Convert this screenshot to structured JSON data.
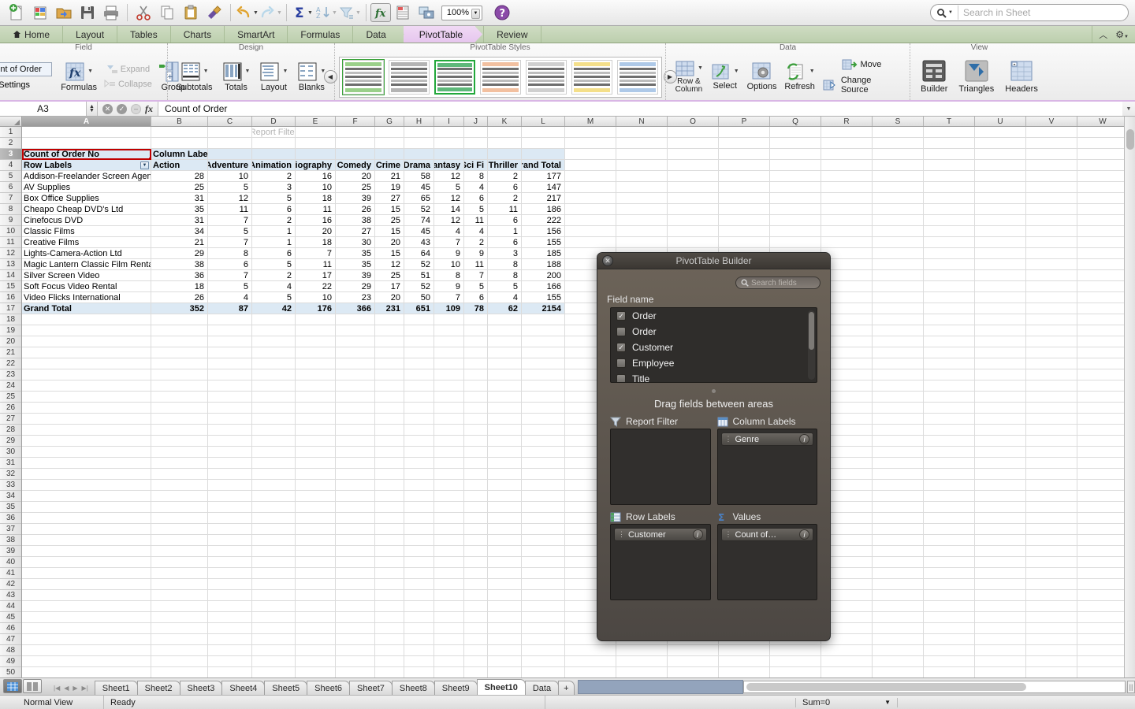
{
  "app": {
    "zoom_level": "100%",
    "search_placeholder": "Search in Sheet"
  },
  "toolbar": {
    "items": [
      {
        "name": "new-document-icon",
        "label": "New"
      },
      {
        "name": "open-template-icon",
        "label": "Templates"
      },
      {
        "name": "open-folder-icon",
        "label": "Open"
      },
      {
        "name": "save-icon",
        "label": "Save"
      },
      {
        "name": "print-icon",
        "label": "Print"
      },
      {
        "name": "cut-icon",
        "label": "Cut"
      },
      {
        "name": "copy-icon",
        "label": "Copy"
      },
      {
        "name": "paste-icon",
        "label": "Paste"
      },
      {
        "name": "format-painter-icon",
        "label": "Format"
      },
      {
        "name": "undo-icon",
        "label": "Undo"
      },
      {
        "name": "redo-icon",
        "label": "Redo"
      },
      {
        "name": "autosum-icon",
        "label": "AutoSum"
      },
      {
        "name": "sort-az-icon",
        "label": "Sort"
      },
      {
        "name": "filter-icon",
        "label": "Filter"
      },
      {
        "name": "formula-builder-icon",
        "label": "Formula Builder"
      },
      {
        "name": "toolbox-icon",
        "label": "Toolbox"
      },
      {
        "name": "media-browser-icon",
        "label": "Media"
      }
    ],
    "help_label": "?"
  },
  "ribbon_tabs": [
    {
      "label": "Home",
      "icon": "home-icon",
      "active": false
    },
    {
      "label": "Layout",
      "active": false
    },
    {
      "label": "Tables",
      "active": false
    },
    {
      "label": "Charts",
      "active": false
    },
    {
      "label": "SmartArt",
      "active": false
    },
    {
      "label": "Formulas",
      "active": false
    },
    {
      "label": "Data",
      "active": false
    },
    {
      "label": "PivotTable",
      "active": true
    },
    {
      "label": "Review",
      "active": false
    }
  ],
  "ribbon": {
    "groups": [
      {
        "title": "Field",
        "field_name_value": "Count of Order",
        "settings_label": "Settings",
        "items": [
          {
            "label": "Formulas",
            "icon": "formulas-icon",
            "enabled": true,
            "caret": true
          },
          {
            "label": "Expand",
            "icon": "expand-icon",
            "enabled": false
          },
          {
            "label": "Collapse",
            "icon": "collapse-icon",
            "enabled": false
          },
          {
            "label": "Group",
            "icon": "group-icon",
            "enabled": true,
            "caret": true
          }
        ]
      },
      {
        "title": "Design",
        "items": [
          {
            "label": "Subtotals",
            "icon": "subtotals-icon",
            "caret": true
          },
          {
            "label": "Totals",
            "icon": "totals-icon",
            "caret": true
          },
          {
            "label": "Layout",
            "icon": "layout-icon",
            "caret": true
          },
          {
            "label": "Blanks",
            "icon": "blanks-icon",
            "caret": true
          }
        ]
      },
      {
        "title": "PivotTable Styles",
        "styles": [
          {
            "name": "style-light-green",
            "accent": "#9ad08a",
            "selected": false,
            "outlined": true
          },
          {
            "name": "style-grey",
            "accent": "#b4b4b4",
            "selected": false
          },
          {
            "name": "style-green-selected",
            "accent": "#5eb87a",
            "selected": true
          },
          {
            "name": "style-orange",
            "accent": "#f2c0a0",
            "selected": false
          },
          {
            "name": "style-plain",
            "accent": "#cfcfcf",
            "selected": false
          },
          {
            "name": "style-yellow",
            "accent": "#f4df8a",
            "selected": false
          },
          {
            "name": "style-blue",
            "accent": "#aec9e8",
            "selected": false
          }
        ],
        "prev_label": "◀",
        "next_label": "▶"
      },
      {
        "title": "Data",
        "items": [
          {
            "label": "Row &\nColumn",
            "icon": "row-column-icon",
            "caret": true
          },
          {
            "label": "Select",
            "icon": "select-icon",
            "caret": true
          },
          {
            "label": "Options",
            "icon": "options-icon"
          },
          {
            "label": "Refresh",
            "icon": "refresh-icon",
            "caret": true
          },
          {
            "label": "Move",
            "icon": "move-icon"
          },
          {
            "label": "Change Source",
            "icon": "change-source-icon"
          }
        ]
      },
      {
        "title": "View",
        "items": [
          {
            "label": "Builder",
            "icon": "builder-icon"
          },
          {
            "label": "Triangles",
            "icon": "triangles-icon"
          },
          {
            "label": "Headers",
            "icon": "headers-icon"
          }
        ]
      }
    ]
  },
  "formula_bar": {
    "name_box": "A3",
    "cancel_icon": "cancel-icon",
    "accept_icon": "accept-icon",
    "fx_label": "fx",
    "content": "Count of Order"
  },
  "grid": {
    "columns": [
      "A",
      "B",
      "C",
      "D",
      "E",
      "F",
      "G",
      "H",
      "I",
      "J",
      "K",
      "L",
      "M",
      "N",
      "O",
      "P",
      "Q",
      "R",
      "S",
      "T",
      "U",
      "V",
      "W"
    ],
    "selected_column": "A",
    "rows_visible": 50,
    "report_filter_hint": "Report Filter",
    "pivot": {
      "title_cell": "Count of Order  No",
      "column_labels_cell": "Column Labels",
      "row_labels_cell": "Row Labels",
      "headers": [
        "Action",
        "Adventure",
        "Animation",
        "Biography",
        "Comedy",
        "Crime",
        "Drama",
        "Fantasy",
        "Sci Fi",
        "Thriller",
        "Grand Total"
      ],
      "rows": [
        {
          "label": "Addison-Freelander Screen Agency",
          "values": [
            28,
            10,
            2,
            16,
            20,
            21,
            58,
            12,
            8,
            2,
            177
          ]
        },
        {
          "label": "AV Supplies",
          "values": [
            25,
            5,
            3,
            10,
            25,
            19,
            45,
            5,
            4,
            6,
            147
          ]
        },
        {
          "label": "Box Office Supplies",
          "values": [
            31,
            12,
            5,
            18,
            39,
            27,
            65,
            12,
            6,
            2,
            217
          ]
        },
        {
          "label": "Cheapo Cheap DVD's Ltd",
          "values": [
            35,
            11,
            6,
            11,
            26,
            15,
            52,
            14,
            5,
            11,
            186
          ]
        },
        {
          "label": "Cinefocus DVD",
          "values": [
            31,
            7,
            2,
            16,
            38,
            25,
            74,
            12,
            11,
            6,
            222
          ]
        },
        {
          "label": "Classic Films",
          "values": [
            34,
            5,
            1,
            20,
            27,
            15,
            45,
            4,
            4,
            1,
            156
          ]
        },
        {
          "label": "Creative Films",
          "values": [
            21,
            7,
            1,
            18,
            30,
            20,
            43,
            7,
            2,
            6,
            155
          ]
        },
        {
          "label": "Lights-Camera-Action Ltd",
          "values": [
            29,
            8,
            6,
            7,
            35,
            15,
            64,
            9,
            9,
            3,
            185
          ]
        },
        {
          "label": "Magic Lantern Classic Film Rental",
          "values": [
            38,
            6,
            5,
            11,
            35,
            12,
            52,
            10,
            11,
            8,
            188
          ]
        },
        {
          "label": "Silver Screen Video",
          "values": [
            36,
            7,
            2,
            17,
            39,
            25,
            51,
            8,
            7,
            8,
            200
          ]
        },
        {
          "label": "Soft Focus Video Rental",
          "values": [
            18,
            5,
            4,
            22,
            29,
            17,
            52,
            9,
            5,
            5,
            166
          ]
        },
        {
          "label": "Video Flicks International",
          "values": [
            26,
            4,
            5,
            10,
            23,
            20,
            50,
            7,
            6,
            4,
            155
          ]
        }
      ],
      "grand_total_label": "Grand Total",
      "grand_total_values": [
        352,
        87,
        42,
        176,
        366,
        231,
        651,
        109,
        78,
        62,
        2154
      ]
    }
  },
  "builder": {
    "title": "PivotTable Builder",
    "close_icon": "close-icon",
    "search_placeholder": "Search fields",
    "search_icon": "search-icon",
    "field_name_label": "Field name",
    "fields": [
      {
        "name": "Order",
        "checked": true
      },
      {
        "name": "Order",
        "checked": false
      },
      {
        "name": "Customer",
        "checked": true
      },
      {
        "name": "Employee",
        "checked": false
      },
      {
        "name": "Title",
        "checked": false
      }
    ],
    "drag_hint": "Drag fields between areas",
    "areas": [
      {
        "key": "report_filter",
        "label": "Report Filter",
        "icon": "filter-funnel-icon",
        "chips": []
      },
      {
        "key": "column_labels",
        "label": "Column Labels",
        "icon": "column-labels-icon",
        "chips": [
          "Genre"
        ]
      },
      {
        "key": "row_labels",
        "label": "Row Labels",
        "icon": "row-labels-icon",
        "chips": [
          "Customer"
        ]
      },
      {
        "key": "values",
        "label": "Values",
        "icon": "sigma-icon",
        "chips": [
          "Count of…"
        ]
      }
    ]
  },
  "sheet_tabs": {
    "tabs": [
      "Sheet1",
      "Sheet2",
      "Sheet3",
      "Sheet4",
      "Sheet5",
      "Sheet6",
      "Sheet7",
      "Sheet8",
      "Sheet9",
      "Sheet10",
      "Data"
    ],
    "active": "Sheet10",
    "add_label": "+",
    "nav": [
      "⏮",
      "◀",
      "▶",
      "⏭"
    ]
  },
  "status_bar": {
    "view_mode": "Normal View",
    "state": "Ready",
    "sum": "Sum=0"
  },
  "colors": {
    "pivot_header_bg": "#dce9f4",
    "selection_border": "#c00000",
    "active_tab": "#e6c6ee",
    "ribbon_green": "#bccfae"
  }
}
